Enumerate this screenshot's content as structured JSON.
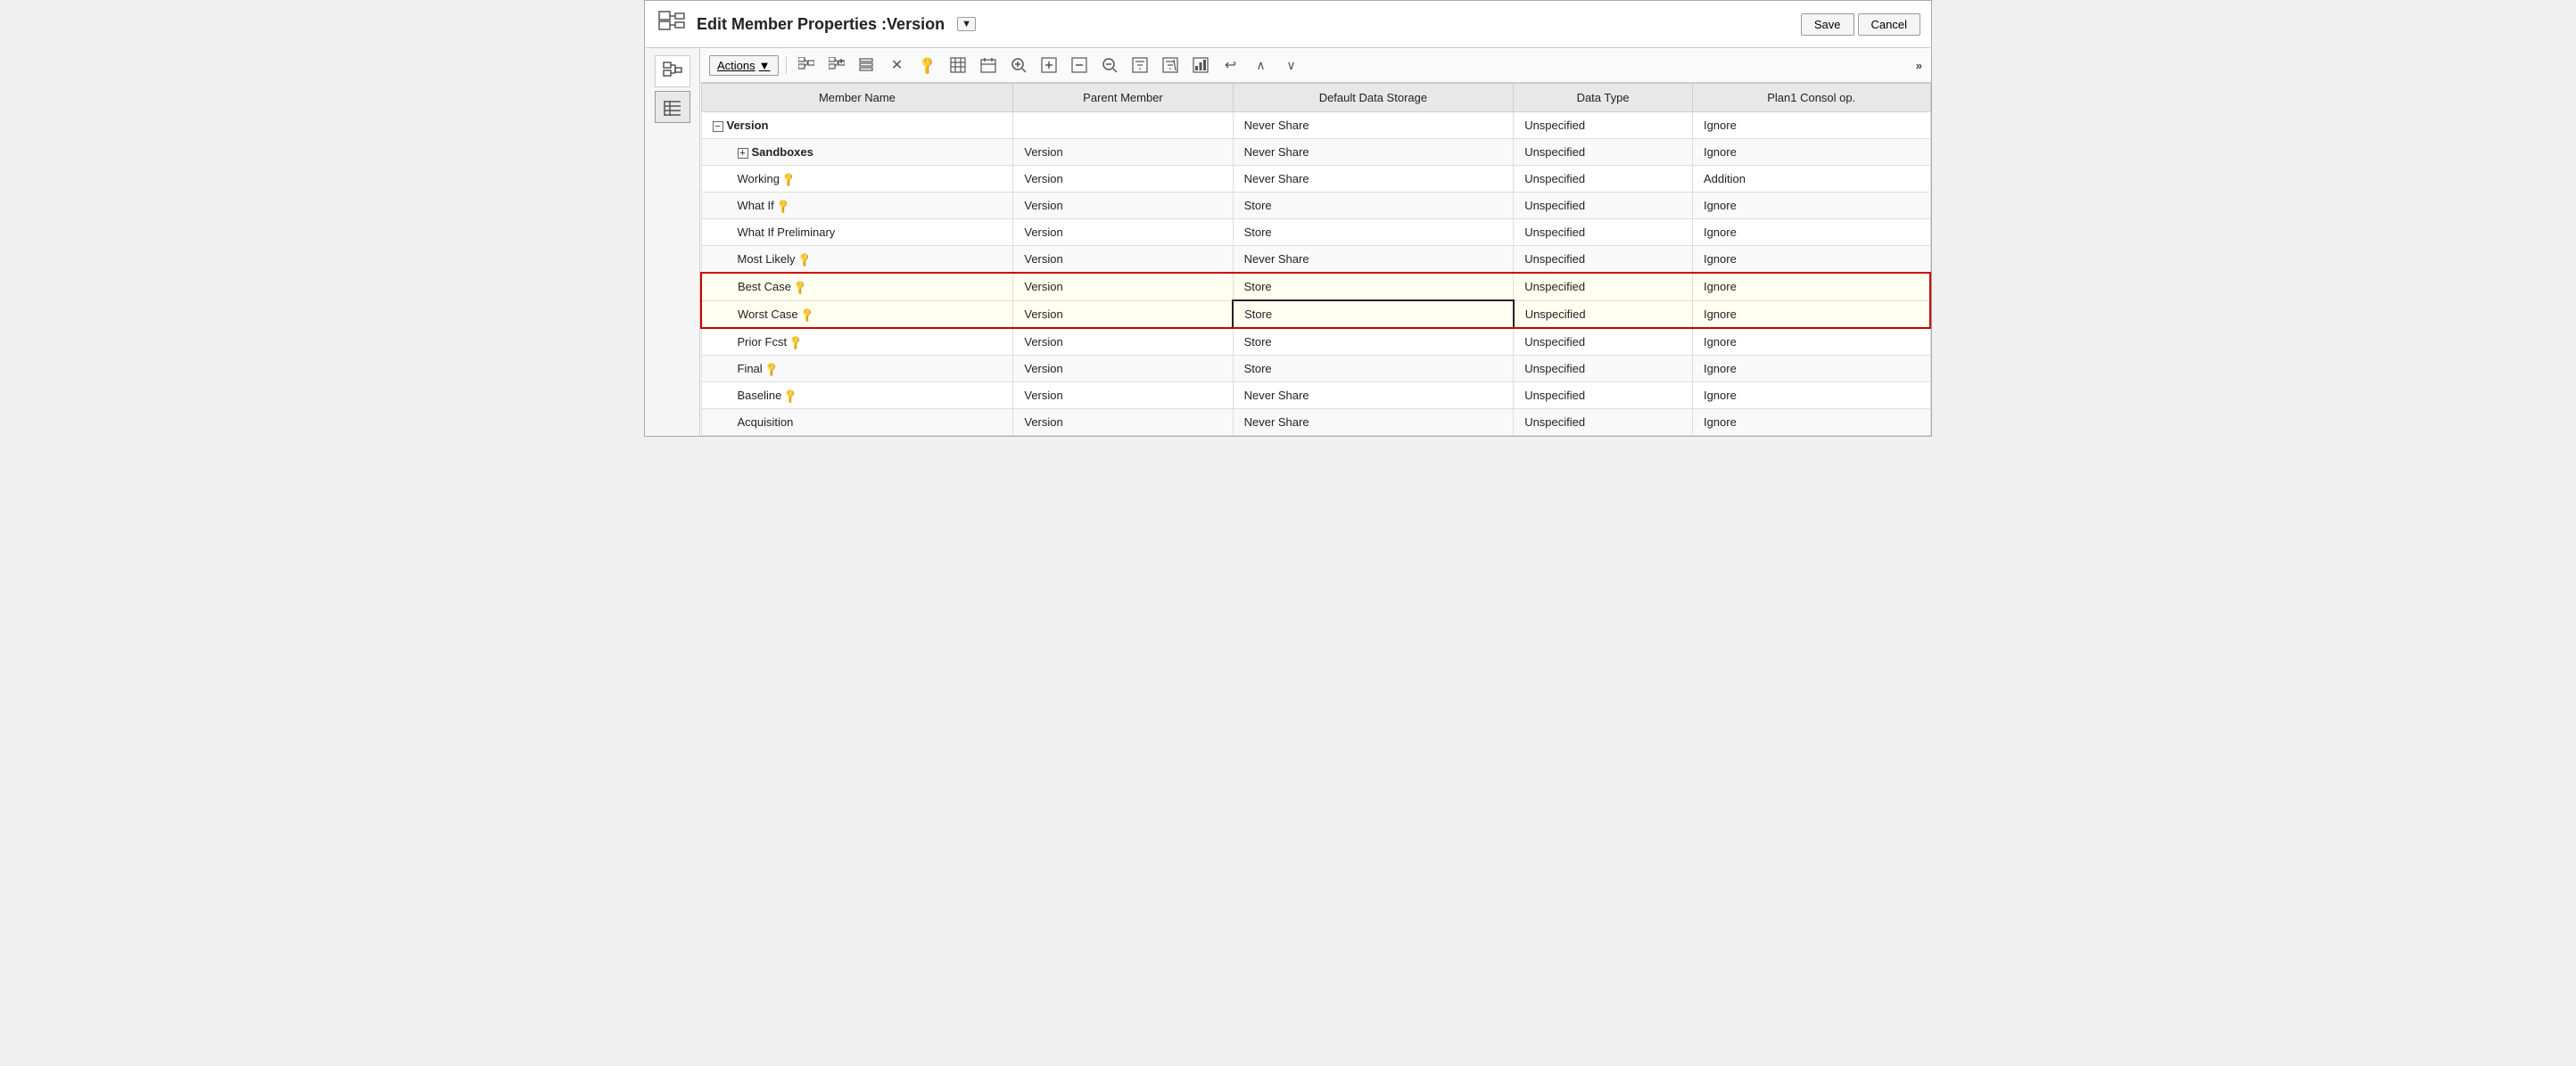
{
  "header": {
    "title": "Edit Member Properties :Version",
    "save_label": "Save",
    "cancel_label": "Cancel",
    "dropdown_symbol": "▼"
  },
  "toolbar": {
    "actions_label": "Actions",
    "actions_dropdown": "▼",
    "more_label": "»",
    "icons": [
      {
        "name": "hierarchy-icon",
        "symbol": "⊞",
        "title": "Hierarchy"
      },
      {
        "name": "add-member-icon",
        "symbol": "⊞",
        "title": "Add Member"
      },
      {
        "name": "edit-member-icon",
        "symbol": "≣",
        "title": "Edit Member"
      },
      {
        "name": "delete-icon",
        "symbol": "✕",
        "title": "Delete"
      },
      {
        "name": "key-icon",
        "symbol": "🔑",
        "title": "Key"
      },
      {
        "name": "table-icon",
        "symbol": "⊟",
        "title": "Table"
      },
      {
        "name": "calendar-icon",
        "symbol": "📋",
        "title": "Calendar"
      },
      {
        "name": "zoom-in-icon",
        "symbol": "🔍",
        "title": "Zoom In"
      },
      {
        "name": "expand-icon",
        "symbol": "⊞",
        "title": "Expand"
      },
      {
        "name": "collapse-icon",
        "symbol": "⊟",
        "title": "Collapse"
      },
      {
        "name": "zoom-out-icon",
        "symbol": "🔍",
        "title": "Zoom Out"
      },
      {
        "name": "filter-icon",
        "symbol": "⊟",
        "title": "Filter"
      },
      {
        "name": "filter2-icon",
        "symbol": "⊠",
        "title": "Filter 2"
      },
      {
        "name": "chart-icon",
        "symbol": "▦",
        "title": "Chart"
      },
      {
        "name": "undo-icon",
        "symbol": "↩",
        "title": "Undo"
      },
      {
        "name": "up-icon",
        "symbol": "∧",
        "title": "Move Up"
      },
      {
        "name": "down-icon",
        "symbol": "∨",
        "title": "Move Down"
      }
    ]
  },
  "table": {
    "columns": [
      {
        "id": "member-name",
        "label": "Member Name"
      },
      {
        "id": "parent-member",
        "label": "Parent Member"
      },
      {
        "id": "default-data-storage",
        "label": "Default Data Storage"
      },
      {
        "id": "data-type",
        "label": "Data Type"
      },
      {
        "id": "plan1-consol-op",
        "label": "Plan1 Consol op."
      }
    ],
    "rows": [
      {
        "id": "version",
        "member_name": "Version",
        "has_expand": true,
        "expand_symbol": "−",
        "indent": 0,
        "bold": true,
        "parent_member": "",
        "default_data_storage": "Never Share",
        "data_type": "Unspecified",
        "plan1_consol_op": "Ignore"
      },
      {
        "id": "sandboxes",
        "member_name": "Sandboxes",
        "has_expand": true,
        "expand_symbol": "+",
        "indent": 1,
        "bold": true,
        "parent_member": "Version",
        "default_data_storage": "Never Share",
        "data_type": "Unspecified",
        "plan1_consol_op": "Ignore"
      },
      {
        "id": "working",
        "member_name": "Working",
        "has_key": true,
        "indent": 1,
        "bold": false,
        "parent_member": "Version",
        "default_data_storage": "Never Share",
        "data_type": "Unspecified",
        "plan1_consol_op": "Addition"
      },
      {
        "id": "what-if",
        "member_name": "What If",
        "has_key": true,
        "indent": 1,
        "bold": false,
        "parent_member": "Version",
        "default_data_storage": "Store",
        "data_type": "Unspecified",
        "plan1_consol_op": "Ignore"
      },
      {
        "id": "what-if-preliminary",
        "member_name": "What If Preliminary",
        "indent": 1,
        "bold": false,
        "parent_member": "Version",
        "default_data_storage": "Store",
        "data_type": "Unspecified",
        "plan1_consol_op": "Ignore"
      },
      {
        "id": "most-likely",
        "member_name": "Most Likely",
        "has_key": true,
        "indent": 1,
        "bold": false,
        "parent_member": "Version",
        "default_data_storage": "Never Share",
        "data_type": "Unspecified",
        "plan1_consol_op": "Ignore"
      },
      {
        "id": "best-case",
        "member_name": "Best Case",
        "has_key": true,
        "indent": 1,
        "bold": false,
        "selected": true,
        "parent_member": "Version",
        "default_data_storage": "Store",
        "data_type": "Unspecified",
        "plan1_consol_op": "Ignore"
      },
      {
        "id": "worst-case",
        "member_name": "Worst Case",
        "has_key": true,
        "indent": 1,
        "bold": false,
        "selected": true,
        "editing_storage": true,
        "parent_member": "Version",
        "default_data_storage": "Store",
        "data_type": "Unspecified",
        "plan1_consol_op": "Ignore"
      },
      {
        "id": "prior-fcst",
        "member_name": "Prior Fcst",
        "has_key": true,
        "indent": 1,
        "bold": false,
        "parent_member": "Version",
        "default_data_storage": "Store",
        "data_type": "Unspecified",
        "plan1_consol_op": "Ignore"
      },
      {
        "id": "final",
        "member_name": "Final",
        "has_key": true,
        "indent": 1,
        "bold": false,
        "parent_member": "Version",
        "default_data_storage": "Store",
        "data_type": "Unspecified",
        "plan1_consol_op": "Ignore"
      },
      {
        "id": "baseline",
        "member_name": "Baseline",
        "has_key": true,
        "indent": 1,
        "bold": false,
        "parent_member": "Version",
        "default_data_storage": "Never Share",
        "data_type": "Unspecified",
        "plan1_consol_op": "Ignore"
      },
      {
        "id": "acquisition",
        "member_name": "Acquisition",
        "indent": 1,
        "bold": false,
        "parent_member": "Version",
        "default_data_storage": "Never Share",
        "data_type": "Unspecified",
        "plan1_consol_op": "Ignore"
      }
    ]
  }
}
